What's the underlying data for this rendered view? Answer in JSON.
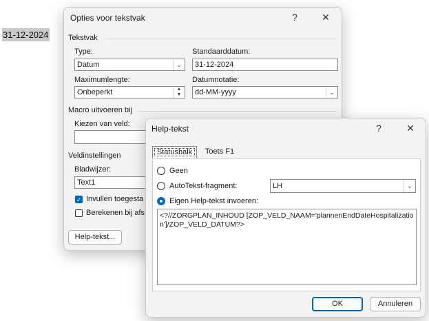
{
  "document": {
    "field_value": "31-12-2024"
  },
  "options_dialog": {
    "title": "Opties voor tekstvak",
    "help_symbol": "?",
    "close_symbol": "✕",
    "textfield_section": "Tekstvak",
    "type_label": "Type:",
    "type_value": "Datum",
    "default_date_label": "Standaarddatum:",
    "default_date_value": "31-12-2024",
    "max_length_label": "Maximumlengte:",
    "max_length_value": "Onbeperkt",
    "date_format_label": "Datumnotatie:",
    "date_format_value": "dd-MM-yyyy",
    "macro_section": "Macro uitvoeren bij",
    "enter_label": "Kiezen van veld:",
    "enter_value": "",
    "field_settings_section": "Veldinstellingen",
    "bookmark_label": "Bladwijzer:",
    "bookmark_value": "Text1",
    "fill_in_label": "Invullen toegesta",
    "fill_in_checked": true,
    "calculate_label": "Berekenen bij afs",
    "calculate_checked": false,
    "help_text_button": "Help-tekst..."
  },
  "help_dialog": {
    "title": "Help-tekst",
    "help_symbol": "?",
    "close_symbol": "✕",
    "tabs": [
      "Statusbalk",
      "Toets F1"
    ],
    "active_tab": "Statusbalk",
    "radio_none": "Geen",
    "radio_autotext": "AutoTekst-fragment:",
    "autotext_value": "LH",
    "radio_custom": "Eigen Help-tekst invoeren:",
    "selected_radio": "custom",
    "custom_text": "<?//ZORGPLAN_INHOUD [ZOP_VELD_NAAM='plannenEndDateHospitalization']/ZOP_VELD_DATUM?>",
    "ok_button": "OK",
    "cancel_button": "Annuleren"
  },
  "colors": {
    "accent": "#0067c0",
    "dialog_bg": "#f3f3f3"
  }
}
